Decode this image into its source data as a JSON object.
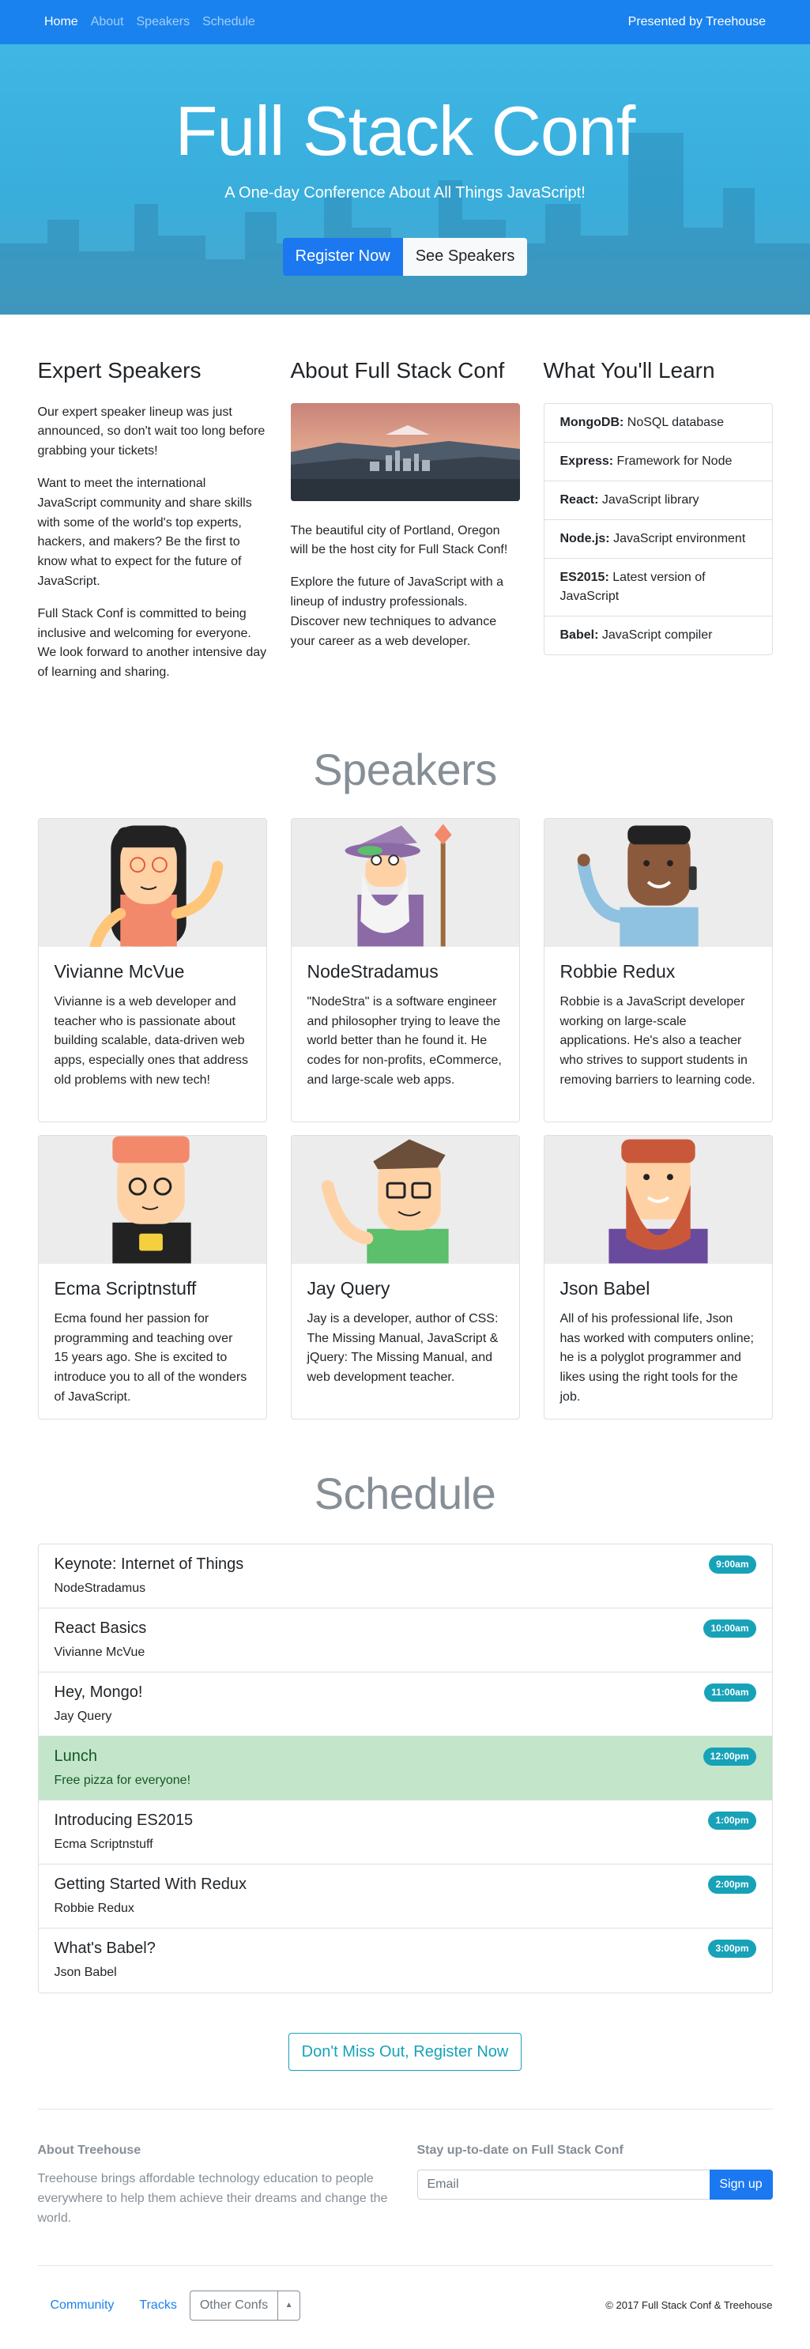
{
  "navbar": {
    "links": [
      "Home",
      "About",
      "Speakers",
      "Schedule"
    ],
    "brand_right": "Presented by Treehouse"
  },
  "hero": {
    "title": "Full Stack Conf",
    "subtitle": "A One-day Conference About All Things JavaScript!",
    "register_label": "Register Now",
    "speakers_label": "See Speakers"
  },
  "info": {
    "expert": {
      "heading": "Expert Speakers",
      "paragraphs": [
        "Our expert speaker lineup was just announced, so don't wait too long before grabbing your tickets!",
        "Want to meet the international JavaScript community and share skills with some of the world's top experts, hackers, and makers? Be the first to know what to expect for the future of JavaScript.",
        "Full Stack Conf is committed to being inclusive and welcoming for everyone. We look forward to another intensive day of learning and sharing."
      ]
    },
    "about": {
      "heading": "About Full Stack Conf",
      "paragraphs": [
        "The beautiful city of Portland, Oregon will be the host city for Full Stack Conf!",
        "Explore the future of JavaScript with a lineup of industry professionals. Discover new techniques to advance your career as a web developer."
      ]
    },
    "learn": {
      "heading": "What You'll Learn",
      "items": [
        {
          "name": "MongoDB:",
          "desc": " NoSQL database"
        },
        {
          "name": "Express:",
          "desc": " Framework for Node"
        },
        {
          "name": "React:",
          "desc": " JavaScript library"
        },
        {
          "name": "Node.js:",
          "desc": " JavaScript environment"
        },
        {
          "name": "ES2015:",
          "desc": " Latest version of JavaScript"
        },
        {
          "name": "Babel:",
          "desc": " JavaScript compiler"
        }
      ]
    }
  },
  "speakers": {
    "title": "Speakers",
    "list": [
      {
        "name": "Vivianne McVue",
        "bio": "Vivianne is a web developer and teacher who is passionate about building scalable, data-driven web apps, especially ones that address old problems with new tech!"
      },
      {
        "name": "NodeStradamus",
        "bio": "\"NodeStra\" is a software engineer and philosopher trying to leave the world better than he found it. He codes for non-profits, eCommerce, and large-scale web apps."
      },
      {
        "name": "Robbie Redux",
        "bio": "Robbie is a JavaScript developer working on large-scale applications. He's also a teacher who strives to support students in removing barriers to learning code."
      },
      {
        "name": "Ecma Scriptnstuff",
        "bio": "Ecma found her passion for programming and teaching over 15 years ago. She is excited to introduce you to all of the wonders of JavaScript."
      },
      {
        "name": "Jay Query",
        "bio": "Jay is a developer, author of CSS: The Missing Manual, JavaScript & jQuery: The Missing Manual, and web development teacher."
      },
      {
        "name": "Json Babel",
        "bio": "All of his professional life, Json has worked with computers online; he is a polyglot programmer and likes using the right tools for the job."
      }
    ]
  },
  "schedule": {
    "title": "Schedule",
    "items": [
      {
        "title": "Keynote: Internet of Things",
        "speaker": "NodeStradamus",
        "time": "9:00am"
      },
      {
        "title": "React Basics",
        "speaker": "Vivianne McVue",
        "time": "10:00am"
      },
      {
        "title": "Hey, Mongo!",
        "speaker": "Jay Query",
        "time": "11:00am"
      },
      {
        "title": "Lunch",
        "speaker": "Free pizza for everyone!",
        "time": "12:00pm"
      },
      {
        "title": "Introducing ES2015",
        "speaker": "Ecma Scriptnstuff",
        "time": "1:00pm"
      },
      {
        "title": "Getting Started With Redux",
        "speaker": "Robbie Redux",
        "time": "2:00pm"
      },
      {
        "title": "What's Babel?",
        "speaker": "Json Babel",
        "time": "3:00pm"
      }
    ]
  },
  "cta": {
    "label": "Don't Miss Out, Register Now"
  },
  "footer": {
    "about_heading": "About Treehouse",
    "about_text": "Treehouse brings affordable technology education to people everywhere to help them achieve their dreams and change the world.",
    "signup_heading": "Stay up-to-date on Full Stack Conf",
    "email_placeholder": "Email",
    "signup_label": "Sign up",
    "links": [
      "Community",
      "Tracks"
    ],
    "dropdown_label": "Other Confs",
    "copyright": "© 2017 Full Stack Conf & Treehouse"
  },
  "colors": {
    "navbar": "#1a82ee",
    "hero": "#3fb6e4",
    "primary": "#1b78f0",
    "info": "#17a2b8",
    "success_bg": "#c3e6cb",
    "muted": "#868e96"
  }
}
